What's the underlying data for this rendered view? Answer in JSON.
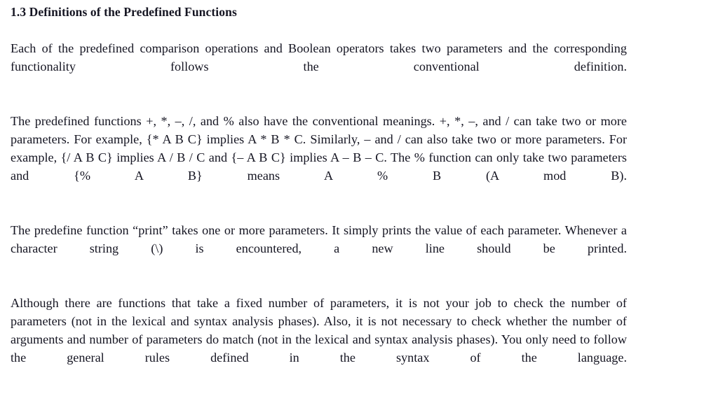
{
  "document": {
    "background_color": "#ffffff",
    "text_color": "#151522",
    "heading": "1.3 Definitions of the Predefined Functions",
    "paragraphs": [
      "Each of the predefined comparison operations and Boolean operators takes two parameters and the corresponding functionality follows the conventional definition.",
      "The predefined functions +, *, –, /, and % also have the conventional meanings. +, *, –, and / can take two or more parameters. For example, {* A B C} implies A * B * C. Similarly, – and / can also take two or more parameters. For example, {/ A B C} implies A / B / C and {– A B C} implies A – B – C. The % function can only take two parameters and {% A B} means A % B (A mod B).",
      "The predefine function “print” takes one or more parameters. It simply prints the value of each parameter. Whenever a character string (\\) is encountered, a new line should be printed.",
      "Although there are functions that take a fixed number of parameters, it is not your job to check the number of parameters (not in the lexical and syntax analysis phases). Also, it is not necessary to check whether the number of arguments and number of parameters do match (not in the lexical and syntax analysis phases). You only need to follow the general rules defined in the syntax of the language."
    ]
  }
}
